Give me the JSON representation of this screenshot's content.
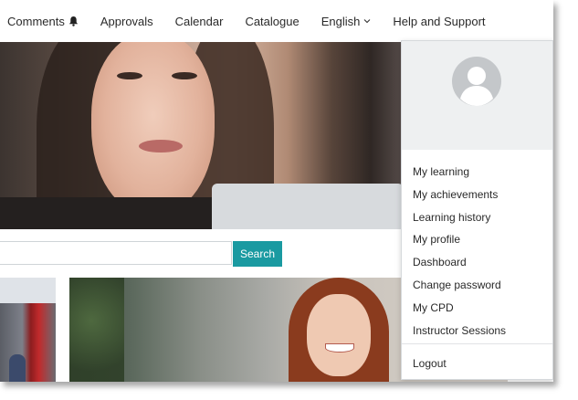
{
  "nav": {
    "items": [
      {
        "label": "Comments",
        "icon": "bell-icon"
      },
      {
        "label": "Approvals"
      },
      {
        "label": "Calendar"
      },
      {
        "label": "Catalogue"
      },
      {
        "label": "English",
        "icon": "chevron-down-icon"
      },
      {
        "label": "Help and Support"
      }
    ]
  },
  "search": {
    "value": "",
    "placeholder": "",
    "button_label": "Search"
  },
  "user_menu": {
    "items": [
      {
        "label": "My learning"
      },
      {
        "label": "My achievements"
      },
      {
        "label": "Learning history"
      },
      {
        "label": "My profile"
      },
      {
        "label": "Dashboard"
      },
      {
        "label": "Change password"
      },
      {
        "label": "My CPD"
      },
      {
        "label": "Instructor Sessions"
      }
    ],
    "logout_label": "Logout"
  },
  "colors": {
    "accent": "#1a9aa1",
    "menu_header_bg": "#eef0f1",
    "avatar": "#c4c7ca"
  }
}
